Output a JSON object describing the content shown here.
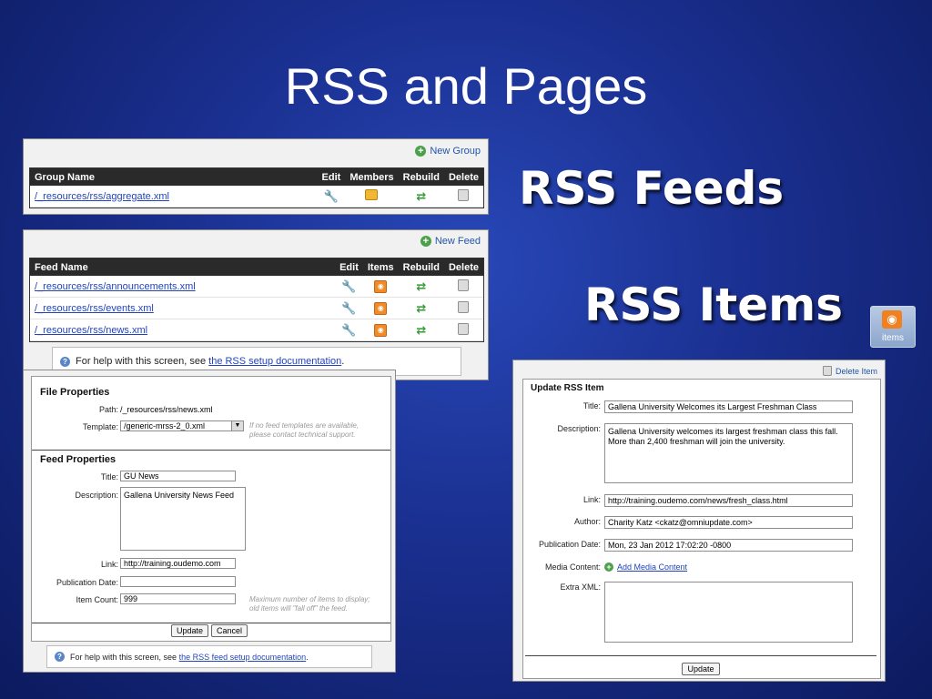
{
  "slide": {
    "title": "RSS and Pages",
    "label_feeds": "RSS Feeds",
    "label_items": "RSS Items",
    "items_button_label": "items"
  },
  "groups_panel": {
    "new_group": "New Group",
    "columns": [
      "Group Name",
      "Edit",
      "Members",
      "Rebuild",
      "Delete"
    ],
    "rows": [
      {
        "name": "/_resources/rss/aggregate.xml"
      }
    ]
  },
  "feeds_panel": {
    "new_feed": "New Feed",
    "columns": [
      "Feed Name",
      "Edit",
      "Items",
      "Rebuild",
      "Delete"
    ],
    "rows": [
      {
        "name": "/_resources/rss/announcements.xml"
      },
      {
        "name": "/_resources/rss/events.xml"
      },
      {
        "name": "/_resources/rss/news.xml"
      }
    ],
    "help_prefix": "For help with this screen, see",
    "help_link": "the RSS setup documentation",
    "help_suffix": "."
  },
  "feed_form": {
    "file_properties": "File Properties",
    "path_label": "Path:",
    "path_value": "/_resources/rss/news.xml",
    "template_label": "Template:",
    "template_value": "/generic-mrss-2_0.xml",
    "template_hint": "If no feed templates are available, please contact technical support.",
    "feed_properties": "Feed Properties",
    "title_label": "Title:",
    "title_value": "GU News",
    "description_label": "Description:",
    "description_value": "Gallena University News Feed",
    "link_label": "Link:",
    "link_value": "http://training.oudemo.com",
    "pubdate_label": "Publication Date:",
    "pubdate_value": "",
    "itemcount_label": "Item Count:",
    "itemcount_value": "999",
    "itemcount_hint": "Maximum number of items to display; old items will \"fall off\" the feed.",
    "update": "Update",
    "cancel": "Cancel",
    "help_prefix": "For help with this screen, see",
    "help_link": "the RSS feed setup documentation",
    "help_suffix": "."
  },
  "item_form": {
    "delete_item": "Delete Item",
    "heading": "Update RSS Item",
    "title_label": "Title:",
    "title_value": "Gallena University Welcomes its Largest Freshman Class",
    "description_label": "Description:",
    "description_value": "Gallena University welcomes its largest freshman class this fall. More than 2,400 freshman will join the university.",
    "link_label": "Link:",
    "link_value": "http://training.oudemo.com/news/fresh_class.html",
    "author_label": "Author:",
    "author_value": "Charity Katz <ckatz@omniupdate.com>",
    "pubdate_label": "Publication Date:",
    "pubdate_value": "Mon, 23 Jan 2012 17:02:20 -0800",
    "media_label": "Media Content:",
    "media_link": "Add Media Content",
    "extra_label": "Extra XML:",
    "extra_value": "",
    "update": "Update"
  }
}
